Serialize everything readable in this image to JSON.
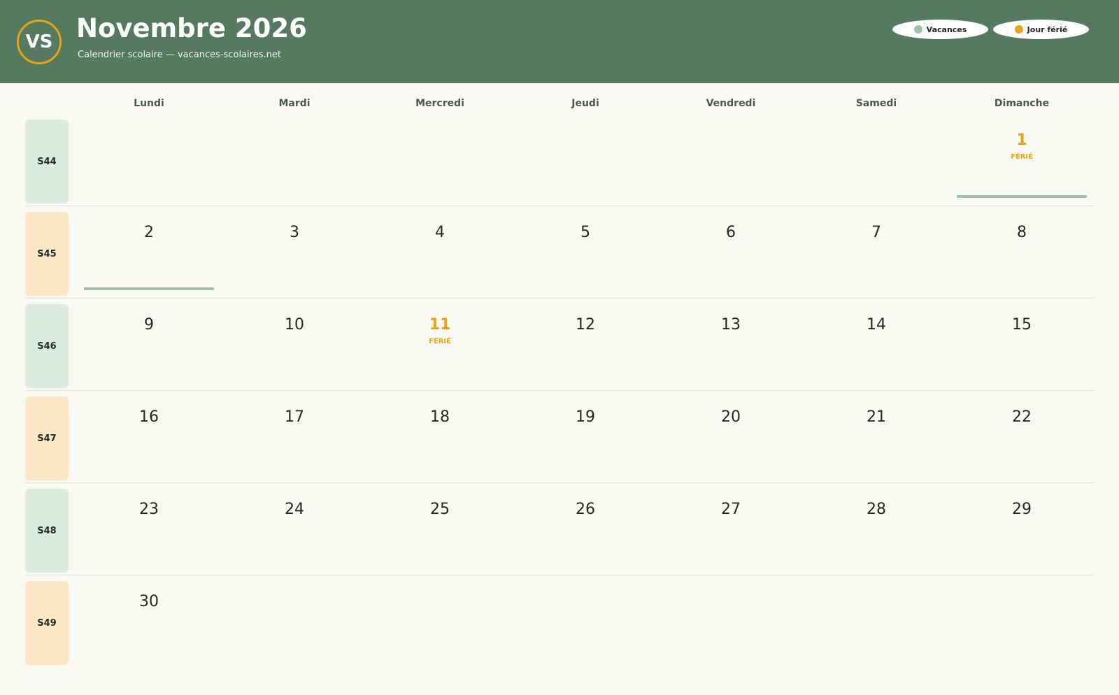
{
  "header": {
    "logo_text": "VS",
    "title": "Novembre 2026",
    "subtitle": "Calendrier scolaire — vacances-scolaires.net",
    "legend": [
      {
        "label": "Vacances",
        "color": "#9cc4aa"
      },
      {
        "label": "Jour férié",
        "color": "#e8a317"
      }
    ]
  },
  "colors": {
    "header_bg": "#557a60",
    "holiday": "#e8a317",
    "vacation": "#9cc4aa",
    "week_even": "#dcebe2",
    "week_odd": "#fde8c6"
  },
  "weekdays": [
    "Lundi",
    "Mardi",
    "Mercredi",
    "Jeudi",
    "Vendredi",
    "Samedi",
    "Dimanche"
  ],
  "weeks": [
    {
      "label": "S44",
      "days": [
        "",
        "",
        "",
        "",
        "",
        "",
        "1"
      ]
    },
    {
      "label": "S45",
      "days": [
        "2",
        "3",
        "4",
        "5",
        "6",
        "7",
        "8"
      ]
    },
    {
      "label": "S46",
      "days": [
        "9",
        "10",
        "11",
        "12",
        "13",
        "14",
        "15"
      ]
    },
    {
      "label": "S47",
      "days": [
        "16",
        "17",
        "18",
        "19",
        "20",
        "21",
        "22"
      ]
    },
    {
      "label": "S48",
      "days": [
        "23",
        "24",
        "25",
        "26",
        "27",
        "28",
        "29"
      ]
    },
    {
      "label": "S49",
      "days": [
        "30",
        "",
        "",
        "",
        "",
        "",
        ""
      ]
    }
  ],
  "holidays": [
    {
      "day": "1",
      "tag": "FÉRIÉ"
    },
    {
      "day": "11",
      "tag": "FÉRIÉ"
    }
  ],
  "vacation_days": [
    "1",
    "2"
  ]
}
